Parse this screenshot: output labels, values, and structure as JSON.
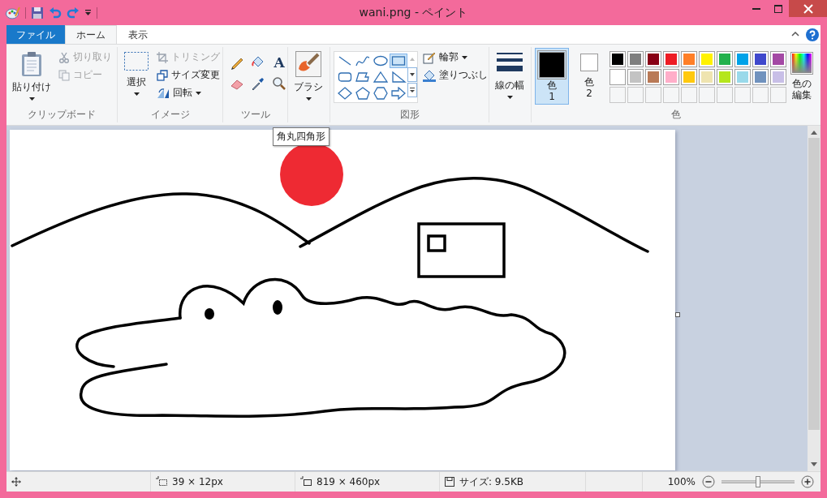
{
  "window": {
    "title": "wani.png - ペイント"
  },
  "tabs": [
    {
      "label": "ファイル",
      "kind": "file",
      "selected": false
    },
    {
      "label": "ホーム",
      "kind": "tab",
      "selected": true
    },
    {
      "label": "表示",
      "kind": "tab",
      "selected": false
    }
  ],
  "ribbon": {
    "clipboard": {
      "paste": "貼り付け",
      "cut": {
        "label": "切り取り",
        "disabled": true
      },
      "copy": {
        "label": "コピー",
        "disabled": true
      },
      "label": "クリップボード"
    },
    "image": {
      "select": "選択",
      "crop": {
        "label": "トリミング",
        "disabled": true
      },
      "resize": {
        "label": "サイズ変更",
        "disabled": false
      },
      "rotate": {
        "label": "回転",
        "disabled": false
      },
      "label": "イメージ"
    },
    "tools": {
      "text_tool": "A",
      "label": "ツール"
    },
    "brush": {
      "label": "ブラシ"
    },
    "shapes": {
      "items": [
        {
          "kind": "line",
          "selected": false
        },
        {
          "kind": "curve",
          "selected": false
        },
        {
          "kind": "oval",
          "selected": false
        },
        {
          "kind": "rectangle",
          "selected": true
        },
        {
          "kind": "rounded-rectangle",
          "selected": false
        },
        {
          "kind": "polygon",
          "selected": false
        },
        {
          "kind": "triangle",
          "selected": false
        },
        {
          "kind": "right-triangle",
          "selected": false
        },
        {
          "kind": "diamond",
          "selected": false
        },
        {
          "kind": "pentagon",
          "selected": false
        },
        {
          "kind": "hexagon",
          "selected": false
        },
        {
          "kind": "right-arrow",
          "selected": false
        }
      ],
      "outline": "輪郭",
      "fill": "塗りつぶし",
      "label": "図形"
    },
    "size": {
      "label": "線の幅"
    },
    "colors": {
      "slots": [
        {
          "label": "色",
          "number": "1",
          "color": "#000000",
          "selected": true
        },
        {
          "label": "色",
          "number": "2",
          "color": "#ffffff",
          "selected": false
        }
      ],
      "palette": [
        {
          "color": "#000000"
        },
        {
          "color": "#7f7f7f"
        },
        {
          "color": "#880015"
        },
        {
          "color": "#ed1c24"
        },
        {
          "color": "#ff7f27"
        },
        {
          "color": "#fff200"
        },
        {
          "color": "#22b14c"
        },
        {
          "color": "#00a2e8"
        },
        {
          "color": "#3f48cc"
        },
        {
          "color": "#a349a4"
        },
        {
          "color": "#ffffff"
        },
        {
          "color": "#c3c3c3"
        },
        {
          "color": "#b97a57"
        },
        {
          "color": "#ffaec9"
        },
        {
          "color": "#ffc90e"
        },
        {
          "color": "#efe4b0"
        },
        {
          "color": "#b5e61d"
        },
        {
          "color": "#99d9ea"
        },
        {
          "color": "#7092be"
        },
        {
          "color": "#c8bfe7"
        }
      ],
      "edit": "色の編集",
      "label": "色"
    }
  },
  "tooltip": "角丸四角形",
  "status_bar": {
    "selection": "39 × 12px",
    "canvas_size": "819 × 460px",
    "file_size": "サイズ: 9.5KB",
    "zoom": "100%",
    "zoom_slider": {
      "level": 0.5
    }
  }
}
